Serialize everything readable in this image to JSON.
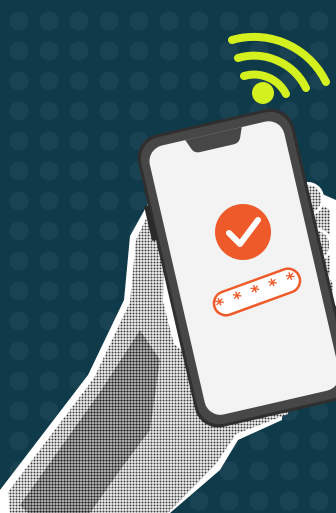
{
  "illustration": {
    "password_mask": "* * * * *",
    "icons": {
      "wifi": "wifi-signal-icon",
      "check": "checkmark-icon"
    },
    "colors": {
      "background": "#0f3a4a",
      "wifi": "#d4f01e",
      "accent": "#ef5a2a",
      "phone_body": "#3a3a3a",
      "screen": "#f3f3f4"
    }
  }
}
